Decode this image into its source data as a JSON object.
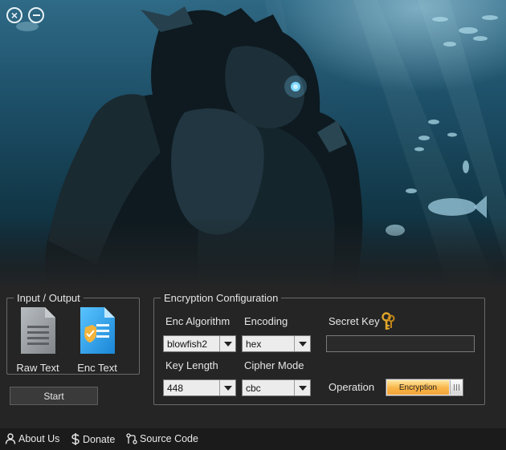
{
  "window": {
    "close_glyph": "×",
    "colors": {
      "background": "#252525",
      "footer": "#1b1b1b",
      "accent": "#f9b446"
    }
  },
  "hero": {
    "image": "underwater-armored-fish-warrior"
  },
  "io": {
    "title": "Input / Output",
    "raw": {
      "label": "Raw Text",
      "icon": "text-file-icon"
    },
    "enc": {
      "label": "Enc Text",
      "icon": "encrypted-file-icon"
    },
    "start_label": "Start"
  },
  "config": {
    "title": "Encryption Configuration",
    "algorithm": {
      "label": "Enc Algorithm",
      "value": "blowfish2"
    },
    "encoding": {
      "label": "Encoding",
      "value": "hex"
    },
    "secret_key": {
      "label": "Secret Key",
      "value": "",
      "icon": "keys-icon"
    },
    "key_length": {
      "label": "Key Length",
      "value": "448"
    },
    "cipher_mode": {
      "label": "Cipher Mode",
      "value": "cbc"
    },
    "operation": {
      "label": "Operation",
      "value": "Encryption"
    }
  },
  "footer": {
    "about": "About Us",
    "donate": "Donate",
    "source": "Source Code"
  }
}
